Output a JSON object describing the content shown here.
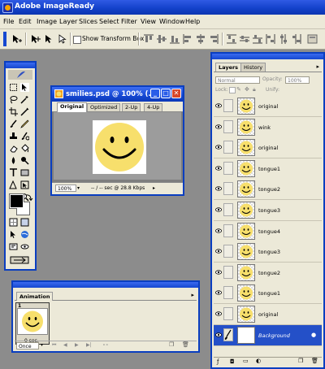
{
  "app": {
    "title": "Adobe ImageReady"
  },
  "menu": [
    "File",
    "Edit",
    "Image",
    "Layer",
    "Slices",
    "Select",
    "Filter",
    "View",
    "Window",
    "Help"
  ],
  "options_bar": {
    "show_transform_box_label": "Show Transform Box"
  },
  "document": {
    "title": "smilies.psd @ 100% (...",
    "tabs": [
      "Original",
      "Optimized",
      "2-Up",
      "4-Up"
    ],
    "active_tab": "Original",
    "zoom": "100%",
    "status": "-- / -- sec @ 28.8 Kbps"
  },
  "layers_palette": {
    "tabs": [
      "Layers",
      "History"
    ],
    "active_tab": "Layers",
    "blend_mode": "Normal",
    "opacity_label": "Opacity:",
    "opacity_value": "100%",
    "lock_label": "Lock:",
    "unify_label": "Unify:",
    "layers": [
      {
        "name": "original",
        "selected": false
      },
      {
        "name": "wink",
        "selected": false
      },
      {
        "name": "original",
        "selected": false
      },
      {
        "name": "tongue1",
        "selected": false
      },
      {
        "name": "tongue2",
        "selected": false
      },
      {
        "name": "tongue3",
        "selected": false
      },
      {
        "name": "tongue4",
        "selected": false
      },
      {
        "name": "tongue3",
        "selected": false
      },
      {
        "name": "tongue2",
        "selected": false
      },
      {
        "name": "tongue1",
        "selected": false
      },
      {
        "name": "original",
        "selected": false
      },
      {
        "name": "Background",
        "selected": true
      }
    ]
  },
  "animation_palette": {
    "tab": "Animation",
    "frames": [
      {
        "number": "1",
        "delay": "0 sec."
      }
    ],
    "loop": "Once"
  },
  "colors": {
    "title_blue": "#1548d0",
    "chrome": "#ece9d8",
    "workspace": "#8c8c8c",
    "smiley": "#f7df6c",
    "close_red": "#d6472a"
  }
}
